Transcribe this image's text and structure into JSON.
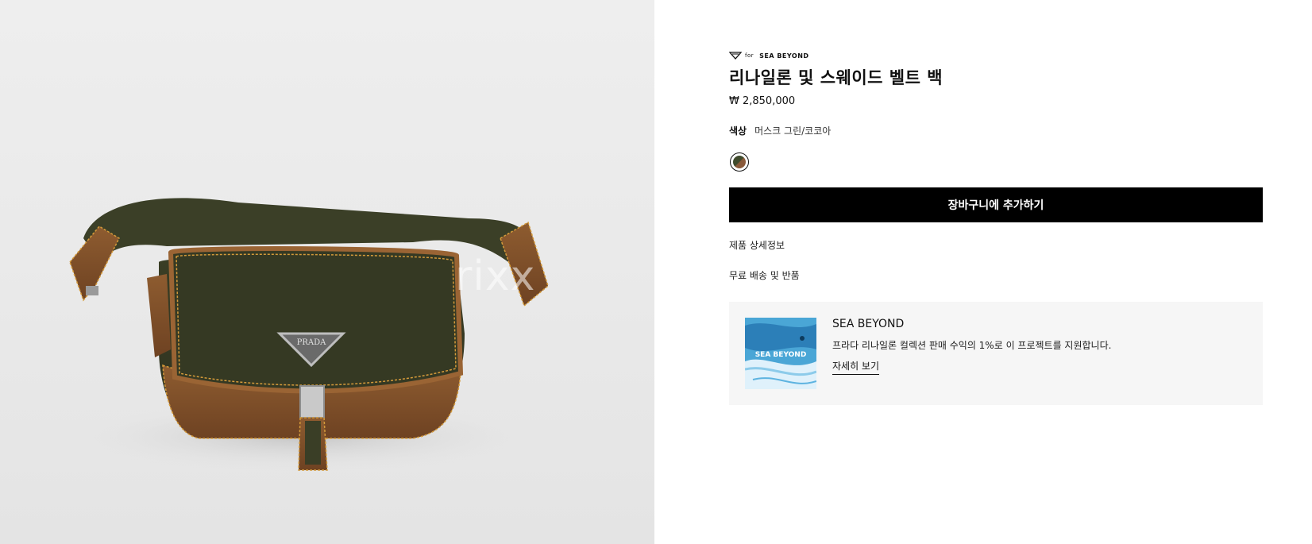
{
  "product_image": {
    "watermark": "rixx",
    "logo_text": "PRADA"
  },
  "brand": {
    "prefix": "for",
    "campaign": "SEA BEYOND"
  },
  "product": {
    "title": "리나일론 및 스웨이드 벨트 백",
    "price": "₩ 2,850,000",
    "color_label": "색상",
    "color_value": "머스크 그린/코코아"
  },
  "actions": {
    "add_to_cart": "장바구니에 추가하기"
  },
  "links": {
    "details": "제품 상세정보",
    "shipping": "무료 배송 및 반품"
  },
  "promo": {
    "image_text": "SEA BEYOND",
    "title": "SEA BEYOND",
    "description": "프라다 리나일론 컬렉션 판매 수익의 1%로 이 프로젝트를 지원합니다.",
    "link": "자세히 보기"
  },
  "colors": {
    "button_bg": "#000000",
    "promo_bg": "#f6f6f6",
    "bag_green": "#3d4128",
    "suede_brown": "#8b5a2b"
  }
}
